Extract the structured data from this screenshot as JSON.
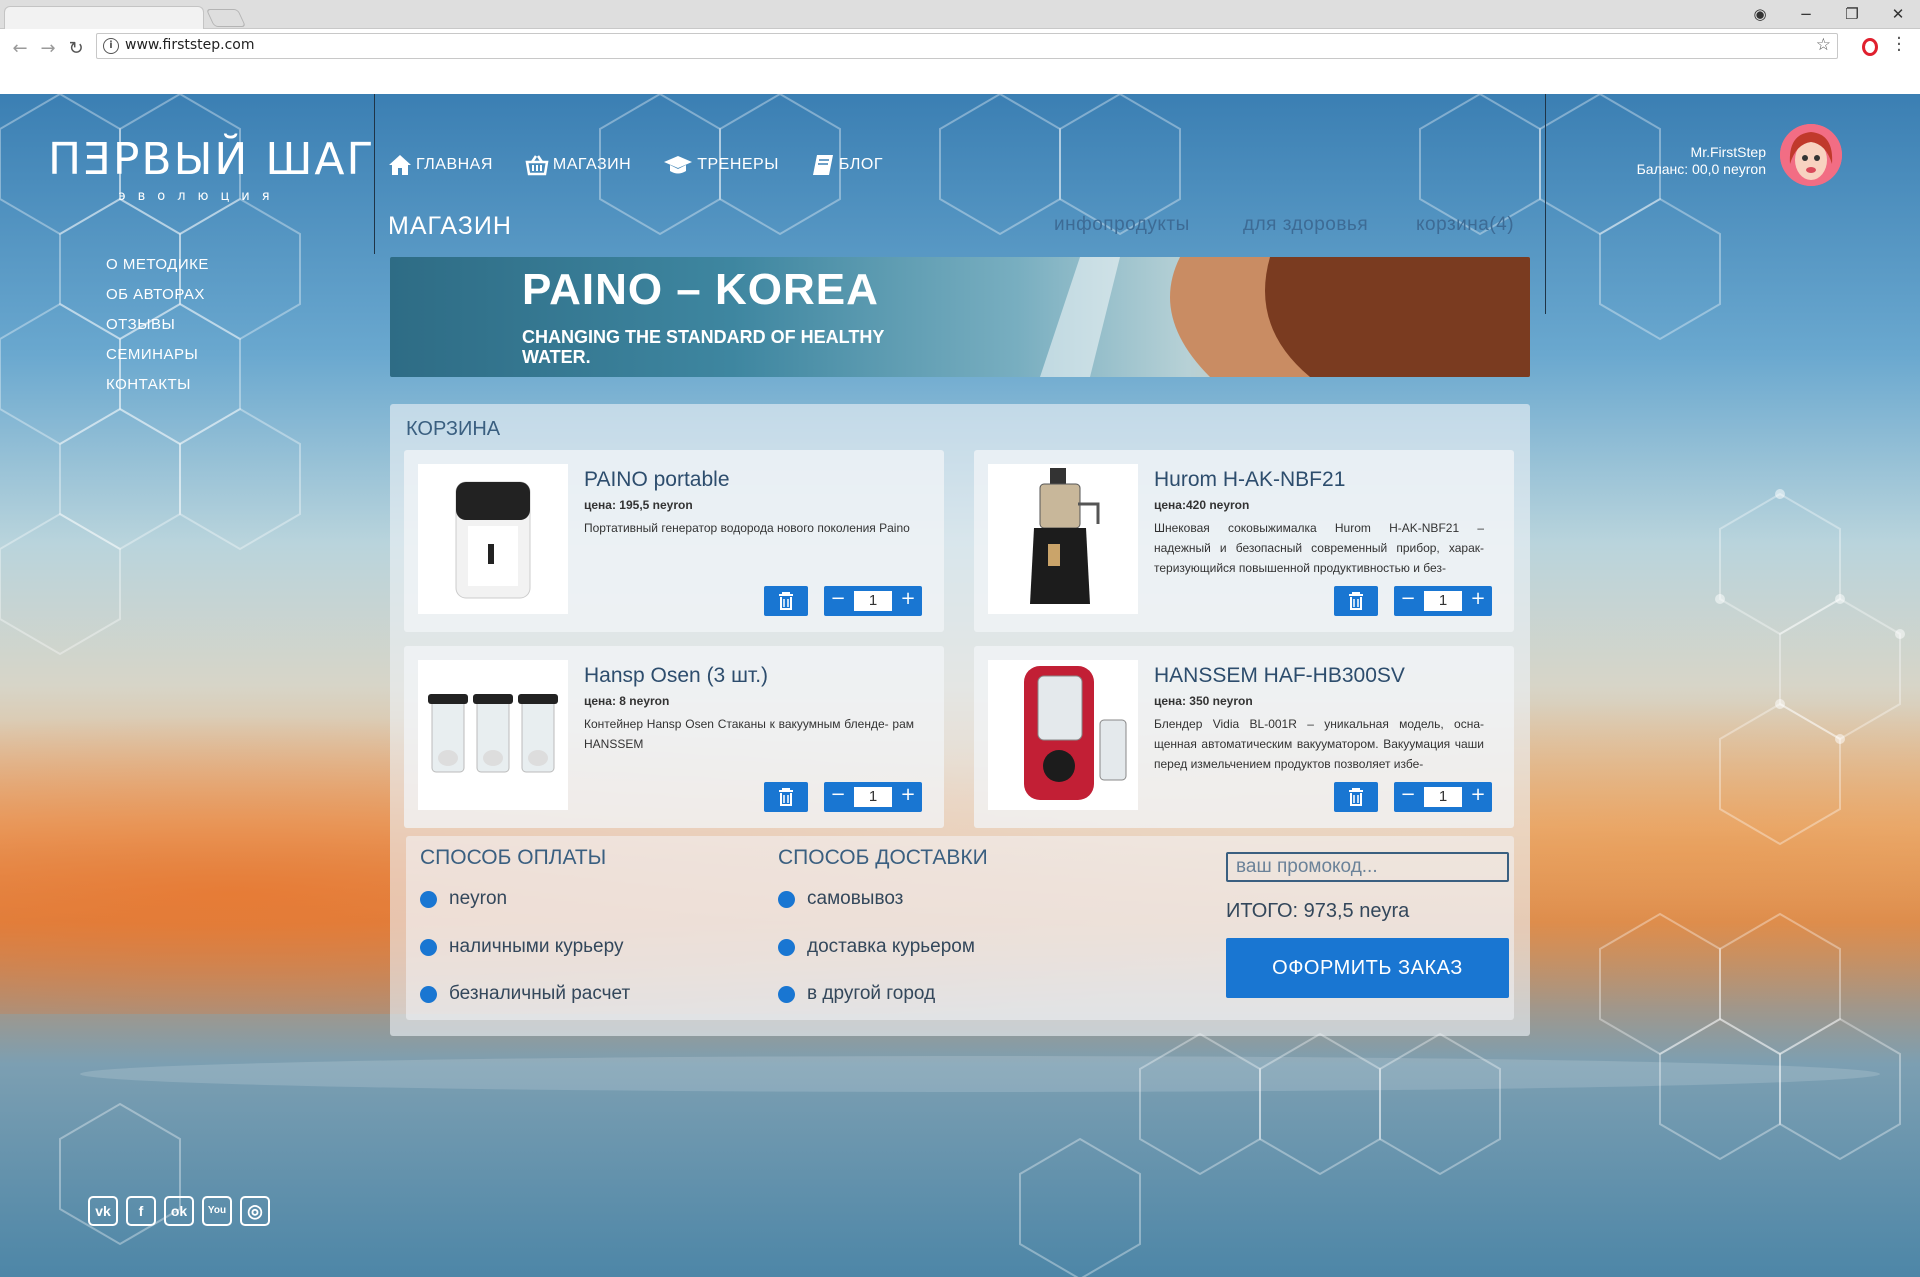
{
  "browser": {
    "url": "www.firststep.com",
    "controls": {
      "profile": "◉",
      "minimize": "−",
      "restore": "❐",
      "close": "✕"
    }
  },
  "logo": {
    "title": "ПƎРВЫЙ ШАГ",
    "subtitle": "эволюция"
  },
  "left_nav": [
    "О МЕТОДИКЕ",
    "ОБ АВТОРАХ",
    "ОТЗЫВЫ",
    "СЕМИНАРЫ",
    "КОНТАКТЫ"
  ],
  "top_nav": [
    {
      "label": "ГЛАВНАЯ",
      "icon": "home-icon"
    },
    {
      "label": "МАГАЗИН",
      "icon": "basket-icon"
    },
    {
      "label": "ТРЕНЕРЫ",
      "icon": "graduation-cap-icon"
    },
    {
      "label": "БЛОГ",
      "icon": "book-icon"
    }
  ],
  "section_title": "МАГАЗИН",
  "sub_nav": {
    "infoproducts": "инфопродукты",
    "health": "для здоровья",
    "cart": "корзина(4)"
  },
  "user": {
    "name": "Mr.FirstStep",
    "balance": "Баланс: 00,0 neyron"
  },
  "banner": {
    "title": "PAINO – KOREA",
    "subtitle": "CHANGING THE STANDARD OF HEALTHY WATER."
  },
  "cart": {
    "title": "КОРЗИНА",
    "items": [
      {
        "name": "PAINO portable",
        "price": "цена: 195,5  neyron",
        "description": "Портативный генератор водорода нового поколения Paino",
        "qty": "1"
      },
      {
        "name": "Hurom H-AK-NBF21",
        "price": "цена:420 neyron",
        "description": "Шнековая соковыжималка Hurom H-AK-NBF21 – надежный и безопасный современный прибор, харак- теризующийся повышенной продуктивностью и без-",
        "qty": "1"
      },
      {
        "name": "Hansp Osen (3 шт.)",
        "price": "цена: 8 neyron",
        "description": "Контейнер Hansp Osen Стаканы к вакуумным бленде- рам HANSSEM",
        "qty": "1"
      },
      {
        "name": "HANSSEM HAF-HB300SV",
        "price": "цена: 350 neyron",
        "description": "Блендер Vidia BL-001R – уникальная модель, осна- щенная автоматическим вакууматором. Вакуумация чаши перед измельчением продуктов позволяет избе-",
        "qty": "1"
      }
    ],
    "qty_minus": "−",
    "qty_plus": "+"
  },
  "payment": {
    "title": "СПОСОБ ОПЛАТЫ",
    "options": [
      "neyron",
      "наличными курьеру",
      "безналичный расчет"
    ]
  },
  "delivery": {
    "title": "СПОСОБ ДОСТАВКИ",
    "options": [
      "самовывоз",
      "доставка курьером",
      "в другой город"
    ]
  },
  "promo": {
    "placeholder": "ваш промокод..."
  },
  "total": "ИТОГО: 973,5 neyra",
  "order_button": "ОФОРМИТЬ ЗАКАЗ",
  "social": [
    {
      "icon": "vk-icon",
      "label": "vk"
    },
    {
      "icon": "facebook-icon",
      "label": "f"
    },
    {
      "icon": "odnoklassniki-icon",
      "label": "ok"
    },
    {
      "icon": "youtube-icon",
      "label": "You"
    },
    {
      "icon": "instagram-icon",
      "label": "◎"
    }
  ],
  "colors": {
    "accent": "#1976d2",
    "heading": "#3a5f80",
    "subnav": "#3d6b95"
  }
}
